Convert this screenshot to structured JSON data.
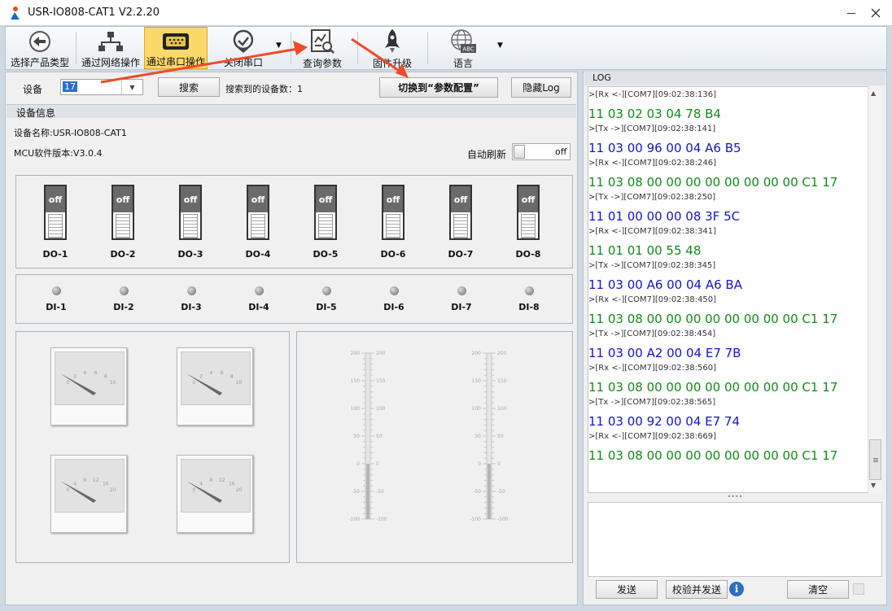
{
  "window": {
    "title": "USR-IO808-CAT1 V2.2.20"
  },
  "toolbar": {
    "items": [
      {
        "label": "选择产品类型"
      },
      {
        "label": "通过网络操作"
      },
      {
        "label": "通过串口操作"
      },
      {
        "label": "关闭串口"
      },
      {
        "label": "查询参数"
      },
      {
        "label": "固件升级"
      },
      {
        "label": "语言"
      }
    ]
  },
  "device_bar": {
    "device_label": "设备",
    "device_value": "17",
    "search_label": "搜索",
    "found_text": "搜索到的设备数：1",
    "switch_label": "切换到“参数配置”",
    "hide_log_label": "隐藏Log"
  },
  "device_info": {
    "group_title": "设备信息",
    "name_text": "设备名称:USR-IO808-CAT1",
    "mcu_text": "MCU软件版本:V3.0.4",
    "auto_refresh_label": "自动刷新",
    "auto_refresh_state": "off"
  },
  "outputs": {
    "state_text": "off",
    "labels": [
      "DO-1",
      "DO-2",
      "DO-3",
      "DO-4",
      "DO-5",
      "DO-6",
      "DO-7",
      "DO-8"
    ]
  },
  "inputs": {
    "labels": [
      "DI-1",
      "DI-2",
      "DI-3",
      "DI-4",
      "DI-5",
      "DI-6",
      "DI-7",
      "DI-8"
    ]
  },
  "gauges": [
    {
      "ticks": [
        "0",
        "2",
        "4",
        "6",
        "8",
        "10"
      ],
      "value": 0
    },
    {
      "ticks": [
        "0",
        "2",
        "4",
        "6",
        "8",
        "10"
      ],
      "value": 0
    },
    {
      "ticks": [
        "0",
        "4",
        "8",
        "12",
        "16",
        "20"
      ],
      "value": 0
    },
    {
      "ticks": [
        "0",
        "4",
        "8",
        "12",
        "16",
        "20"
      ],
      "value": 0
    }
  ],
  "scales": {
    "ticks": [
      "200",
      "150",
      "100",
      "50",
      "0",
      "-50",
      "-100"
    ],
    "values": [
      0,
      0
    ]
  },
  "log": {
    "title": "LOG",
    "lines": [
      {
        "kind": "hdr",
        "text": ">[Rx <-][COM7][09:02:38:136]"
      },
      {
        "kind": "rx",
        "text": "11 03 02 03 04 78 B4"
      },
      {
        "kind": "hdr",
        "text": ">[Tx ->][COM7][09:02:38:141]"
      },
      {
        "kind": "tx",
        "text": "11 03 00 96 00 04 A6 B5"
      },
      {
        "kind": "hdr",
        "text": ">[Rx <-][COM7][09:02:38:246]"
      },
      {
        "kind": "rx",
        "text": "11 03 08 00 00 00 00 00 00 00 00 C1 17"
      },
      {
        "kind": "hdr",
        "text": ">[Tx ->][COM7][09:02:38:250]"
      },
      {
        "kind": "tx",
        "text": "11 01 00 00 00 08 3F 5C"
      },
      {
        "kind": "hdr",
        "text": ">[Rx <-][COM7][09:02:38:341]"
      },
      {
        "kind": "rx",
        "text": "11 01 01 00 55 48"
      },
      {
        "kind": "hdr",
        "text": ">[Tx ->][COM7][09:02:38:345]"
      },
      {
        "kind": "tx",
        "text": "11 03 00 A6 00 04 A6 BA"
      },
      {
        "kind": "hdr",
        "text": ">[Rx <-][COM7][09:02:38:450]"
      },
      {
        "kind": "rx",
        "text": "11 03 08 00 00 00 00 00 00 00 00 C1 17"
      },
      {
        "kind": "hdr",
        "text": ">[Tx ->][COM7][09:02:38:454]"
      },
      {
        "kind": "tx",
        "text": "11 03 00 A2 00 04 E7 7B"
      },
      {
        "kind": "hdr",
        "text": ">[Rx <-][COM7][09:02:38:560]"
      },
      {
        "kind": "rx",
        "text": "11 03 08 00 00 00 00 00 00 00 00 C1 17"
      },
      {
        "kind": "hdr",
        "text": ">[Tx ->][COM7][09:02:38:565]"
      },
      {
        "kind": "tx",
        "text": "11 03 00 92 00 04 E7 74"
      },
      {
        "kind": "hdr",
        "text": ">[Rx <-][COM7][09:02:38:669]"
      },
      {
        "kind": "rx",
        "text": "11 03 08 00 00 00 00 00 00 00 00 C1 17"
      }
    ],
    "send_label": "发送",
    "check_send_label": "校验并发送",
    "info_icon": "i",
    "clear_label": "清空"
  },
  "colors": {
    "accent": "#fbd86a",
    "rx": "#13891a",
    "tx": "#1414c8",
    "arrow": "#f04a2a"
  }
}
